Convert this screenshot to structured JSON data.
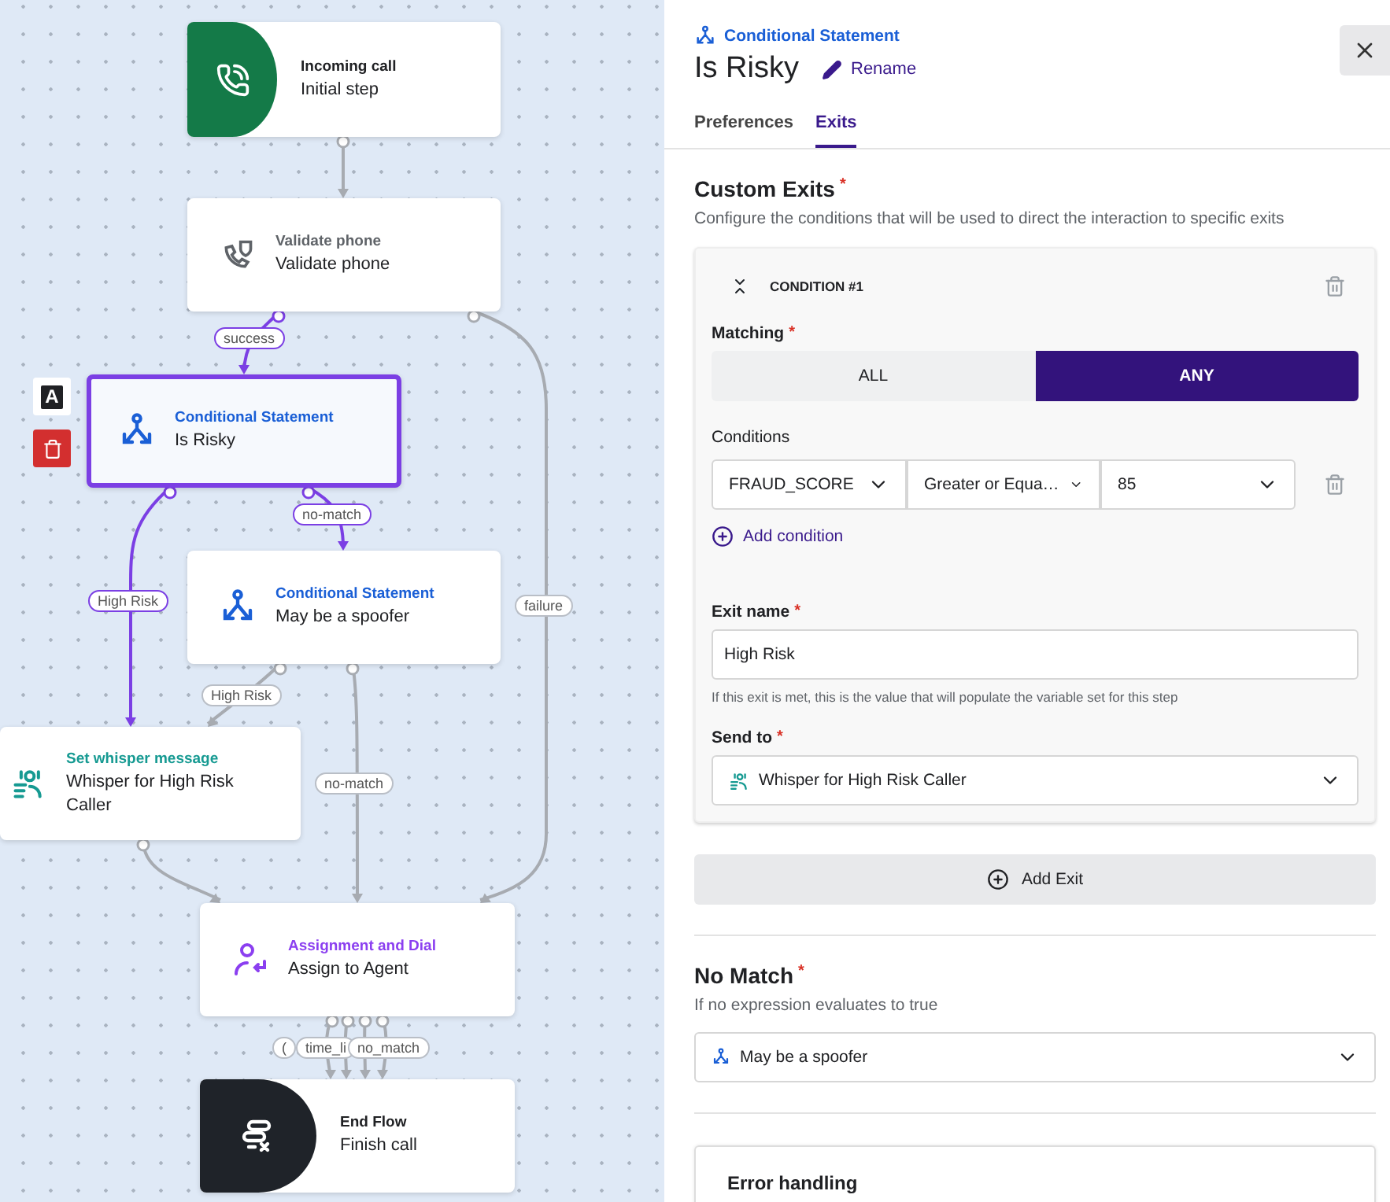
{
  "canvas": {
    "nodes": [
      {
        "kind": "start",
        "category": "Incoming call",
        "name": "Initial step",
        "selected": false
      },
      {
        "kind": "validate",
        "category": "Validate phone",
        "name": "Validate phone",
        "selected": false
      },
      {
        "kind": "conditional",
        "category": "Conditional Statement",
        "name": "Is Risky",
        "selected": true
      },
      {
        "kind": "conditional",
        "category": "Conditional Statement",
        "name": "May be a spoofer",
        "selected": false
      },
      {
        "kind": "whisper",
        "category": "Set whisper message",
        "name": "Whisper for High Risk Caller",
        "selected": false
      },
      {
        "kind": "assign",
        "category": "Assignment and Dial",
        "name": "Assign to Agent",
        "selected": false
      },
      {
        "kind": "end",
        "category": "End Flow",
        "name": "Finish call",
        "selected": false
      }
    ],
    "node_tools": {
      "label_key": "A"
    },
    "edges": [
      {
        "highlighted": false
      },
      {
        "label": "success",
        "highlighted": true
      },
      {
        "label": "failure",
        "highlighted": false
      },
      {
        "label": "High Risk",
        "highlighted": true
      },
      {
        "label": "no-match",
        "highlighted": true
      },
      {
        "label": "High Risk",
        "highlighted": false
      },
      {
        "label": "no-match",
        "highlighted": false
      },
      {
        "highlighted": false
      },
      {
        "label": "(",
        "highlighted": false
      },
      {
        "label": "time_li",
        "highlighted": false
      },
      {
        "label": "no_match",
        "highlighted": false
      },
      {
        "highlighted": false
      }
    ]
  },
  "panel": {
    "category": "Conditional Statement",
    "title": "Is Risky",
    "rename": "Rename",
    "tabs": [
      {
        "label": "Preferences",
        "selected": false
      },
      {
        "label": "Exits",
        "selected": true
      }
    ],
    "custom_exits": {
      "heading": "Custom Exits",
      "required_mark": "*",
      "description": "Configure the conditions that will be used to direct the interaction to specific exits",
      "conditions": [
        {
          "title": "CONDITION #1",
          "expanded": true,
          "matching_label": "Matching",
          "matching_mark": "*",
          "matching_options": [
            {
              "label": "ALL",
              "selected": false
            },
            {
              "label": "ANY",
              "selected": true
            }
          ],
          "conditions_label": "Conditions",
          "rows": [
            {
              "field": "FRAUD_SCORE",
              "operator": "Greater or Equa…",
              "value": "85"
            }
          ],
          "add_condition": "Add condition",
          "exit_name_label": "Exit name",
          "exit_name_mark": "*",
          "exit_name": "High Risk",
          "exit_hint": "If this exit is met, this is the value that will populate the variable set for this step",
          "send_to_label": "Send to",
          "send_to_mark": "*",
          "send_to": "Whisper for High Risk Caller"
        }
      ],
      "add_exit": "Add Exit"
    },
    "no_match": {
      "heading": "No Match",
      "required_mark": "*",
      "description": "If no expression evaluates to true",
      "value": "May be a spoofer"
    },
    "error_handling": {
      "heading": "Error handling"
    }
  }
}
